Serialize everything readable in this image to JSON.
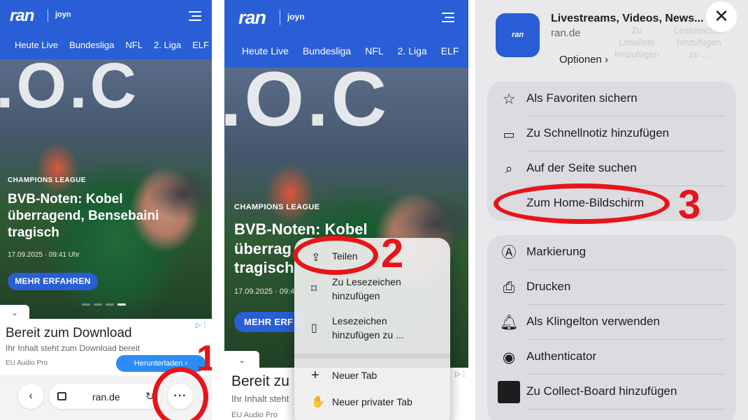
{
  "site": {
    "logo": "ran",
    "partner": "joyn",
    "nav": [
      "Heute Live",
      "Bundesliga",
      "NFL",
      "2. Liga",
      "ELF"
    ]
  },
  "article": {
    "hero_text": ".O.C",
    "tag": "CHAMPIONS LEAGUE",
    "headline_p1": [
      "BVB-Noten: Kobel",
      "überragend, Bensebaini",
      "tragisch"
    ],
    "headline_p2": [
      "BVB-Noten: Kobel",
      "überrag",
      "tragisch"
    ],
    "date_p1": "17.09.2025 · 09:41 Uhr",
    "date_p2": "17.09.2025 · 09:4",
    "button_p1": "MEHR ERFAHREN",
    "button_p2": "MEHR ERF"
  },
  "ad": {
    "title_p1": "Bereit zum Download",
    "title_p2": "Bereit zu",
    "subtitle_p1": "Ihr Inhalt steht zum Download bereit",
    "subtitle_p2": "Ihr Inhalt steht",
    "brand": "EU Audio Pro",
    "button": "Herunterladen"
  },
  "browser": {
    "url": "ran.de",
    "more_icon": "more-horizontal-icon"
  },
  "menu": {
    "items": [
      {
        "icon": "share-icon",
        "label": "Teilen"
      },
      {
        "icon": "bookmark-icon",
        "label": "Zu Lesezeichen hinzufügen"
      },
      {
        "icon": "book-icon",
        "label": "Lesezeichen hinzufügen zu ..."
      },
      {
        "icon": "plus-icon",
        "label": "Neuer Tab"
      },
      {
        "icon": "hand-icon",
        "label": "Neuer privater Tab"
      }
    ]
  },
  "share_sheet": {
    "app_name": "Livestreams, Videos, News...",
    "app_url": "ran.de",
    "options_label": "Optionen",
    "ghost_labels": [
      "Zu Leseliste hinzufügen",
      "Lesezeichen hinzufügen zu ..."
    ],
    "group1": [
      {
        "icon": "star-icon",
        "label": "Als Favoriten sichern"
      },
      {
        "icon": "quick-note-icon",
        "label": "Zu Schnellnotiz hinzufügen"
      },
      {
        "icon": "find-on-page-icon",
        "label": "Auf der Seite suchen"
      },
      {
        "icon": "home-screen-icon",
        "label": "Zum Home-Bildschirm"
      }
    ],
    "group2": [
      {
        "icon": "markup-icon",
        "label": "Markierung"
      },
      {
        "icon": "printer-icon",
        "label": "Drucken"
      },
      {
        "icon": "bell-icon",
        "label": "Als Klingelton verwenden"
      },
      {
        "icon": "authenticator-icon",
        "label": "Authenticator"
      },
      {
        "icon": "collect-board-icon",
        "label": "Zu Collect-Board hinzufügen"
      }
    ]
  },
  "annotations": {
    "step1": "1",
    "step2": "2",
    "step3": "3",
    "color": "#e8141a"
  },
  "colors": {
    "brand_blue": "#2a5ed7",
    "ad_button": "#2b8cf5"
  }
}
